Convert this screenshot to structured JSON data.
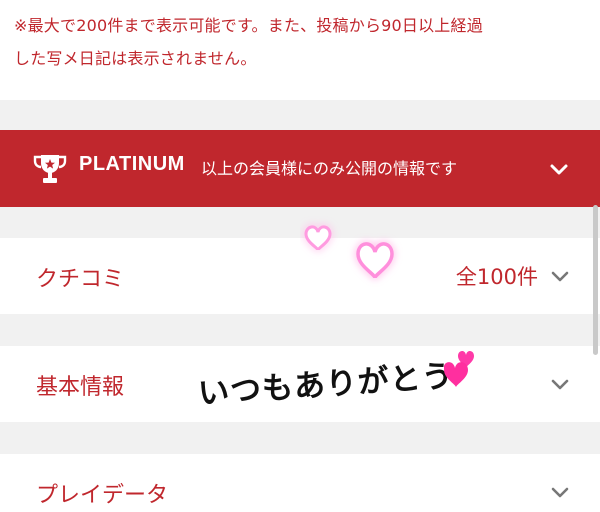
{
  "notice": {
    "line1": "※最大で200件まで表示可能です。また、投稿から90日以上経過",
    "line2": "した写メ日記は表示されません。"
  },
  "platinum_bar": {
    "label": "PLATINUM",
    "text": "以上の会員様にのみ公開の情報です",
    "icon": "trophy-icon",
    "color": "#c0272d"
  },
  "sections": [
    {
      "label": "クチコミ",
      "count": "全100件"
    },
    {
      "label": "基本情報",
      "count": ""
    },
    {
      "label": "プレイデータ",
      "count": ""
    }
  ],
  "overlay": {
    "handwritten_text": "いつもありがとう",
    "sticker": "hearts-sticker"
  }
}
